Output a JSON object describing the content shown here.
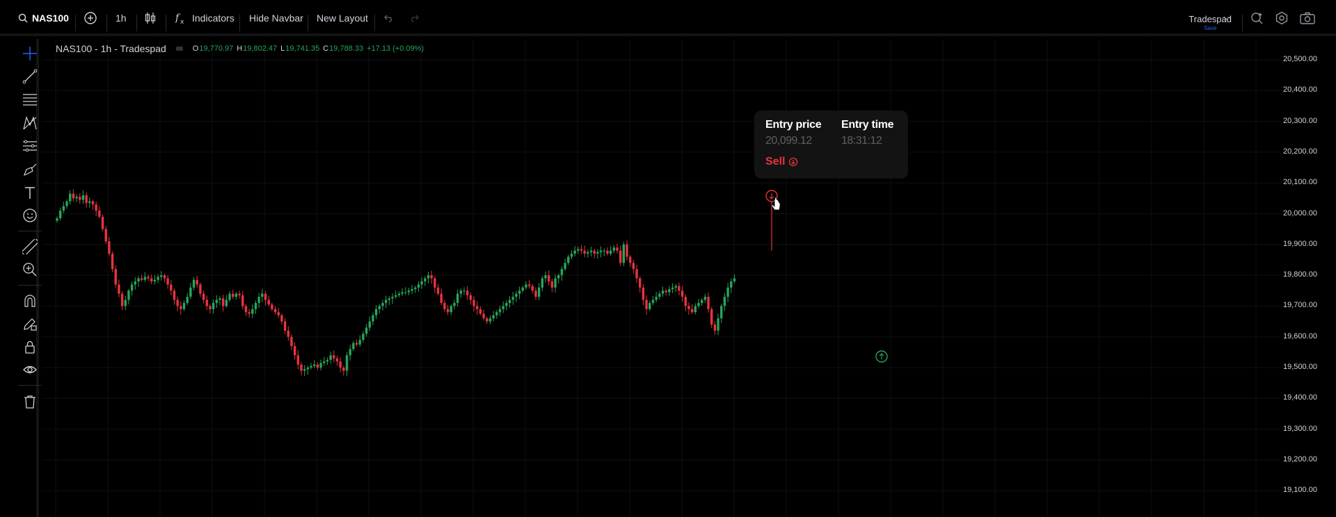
{
  "toolbar": {
    "symbol": "NAS100",
    "interval": "1h",
    "indicators_label": "Indicators",
    "hide_navbar_label": "Hide Navbar",
    "new_layout_label": "New Layout",
    "brand_name": "Tradespad",
    "brand_sub": "Save"
  },
  "legend": {
    "title": "NAS100 - 1h - Tradespad",
    "open_label": "O",
    "open": "19,770.97",
    "high_label": "H",
    "high": "19,802.47",
    "low_label": "L",
    "low": "19,741.35",
    "close_label": "C",
    "close": "19,788.33",
    "change": "+17.13 (+0.09%)"
  },
  "tooltip": {
    "entry_price_label": "Entry price",
    "entry_price": "20,099.12",
    "entry_time_label": "Entry time",
    "entry_time": "18:31:12",
    "action": "Sell"
  },
  "price_scale": [
    "20,500.00",
    "20,400.00",
    "20,300.00",
    "20,200.00",
    "20,100.00",
    "20,000.00",
    "19,900.00",
    "19,800.00",
    "19,700.00",
    "19,600.00",
    "19,500.00",
    "19,400.00",
    "19,300.00",
    "19,200.00",
    "19,100.00"
  ],
  "colors": {
    "up": "#26a65b",
    "down": "#e8333f",
    "background": "#000000",
    "grid": "#101010"
  },
  "chart_data": {
    "type": "candlestick",
    "ylim": [
      19050,
      20535
    ],
    "close_series": [
      19985,
      20010,
      20025,
      20040,
      20065,
      20050,
      20055,
      20045,
      20060,
      20035,
      20040,
      20030,
      20010,
      19990,
      19950,
      19910,
      19870,
      19820,
      19770,
      19740,
      19700,
      19720,
      19750,
      19770,
      19780,
      19790,
      19785,
      19795,
      19790,
      19780,
      19785,
      19795,
      19800,
      19790,
      19770,
      19750,
      19720,
      19700,
      19690,
      19710,
      19730,
      19760,
      19785,
      19770,
      19740,
      19720,
      19700,
      19690,
      19710,
      19720,
      19725,
      19700,
      19720,
      19740,
      19730,
      19740,
      19735,
      19700,
      19680,
      19675,
      19690,
      19710,
      19730,
      19740,
      19720,
      19705,
      19690,
      19680,
      19670,
      19650,
      19620,
      19600,
      19570,
      19540,
      19510,
      19490,
      19495,
      19500,
      19505,
      19510,
      19500,
      19515,
      19520,
      19525,
      19540,
      19530,
      19520,
      19500,
      19490,
      19540,
      19560,
      19580,
      19575,
      19590,
      19610,
      19630,
      19650,
      19670,
      19690,
      19700,
      19710,
      19720,
      19725,
      19730,
      19735,
      19740,
      19745,
      19745,
      19750,
      19755,
      19760,
      19770,
      19780,
      19790,
      19800,
      19790,
      19760,
      19740,
      19710,
      19690,
      19680,
      19700,
      19710,
      19740,
      19750,
      19750,
      19735,
      19720,
      19700,
      19690,
      19675,
      19660,
      19650,
      19660,
      19670,
      19680,
      19690,
      19700,
      19710,
      19720,
      19730,
      19740,
      19750,
      19760,
      19770,
      19765,
      19750,
      19730,
      19760,
      19790,
      19800,
      19780,
      19760,
      19790,
      19800,
      19820,
      19840,
      19860,
      19870,
      19880,
      19885,
      19880,
      19870,
      19875,
      19880,
      19870,
      19875,
      19880,
      19880,
      19870,
      19880,
      19890,
      19880,
      19840,
      19900,
      19860,
      19840,
      19820,
      19790,
      19760,
      19720,
      19690,
      19710,
      19720,
      19730,
      19740,
      19750,
      19745,
      19755,
      19760,
      19765,
      19750,
      19730,
      19700,
      19690,
      19680,
      19700,
      19710,
      19720,
      19730,
      19690,
      19640,
      19620,
      19660,
      19700,
      19730,
      19760,
      19780,
      19790
    ]
  }
}
